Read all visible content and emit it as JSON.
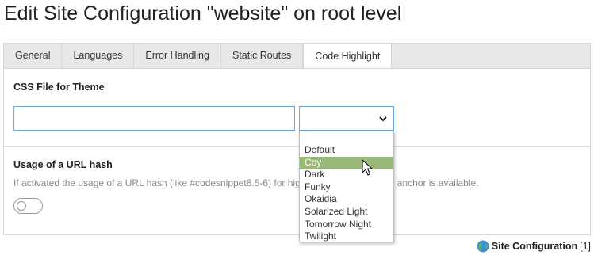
{
  "page": {
    "title": "Edit Site Configuration \"website\" on root level"
  },
  "tabs": [
    {
      "label": "General",
      "active": false
    },
    {
      "label": "Languages",
      "active": false
    },
    {
      "label": "Error Handling",
      "active": false
    },
    {
      "label": "Static Routes",
      "active": false
    },
    {
      "label": "Code Highlight",
      "active": true
    }
  ],
  "css_theme": {
    "label": "CSS File for Theme",
    "input_value": "",
    "select_value": "",
    "options": [
      "Default",
      "Coy",
      "Dark",
      "Funky",
      "Okaidia",
      "Solarized Light",
      "Tomorrow Night",
      "Twilight"
    ],
    "hovered_option": "Coy"
  },
  "url_hash": {
    "label": "Usage of a URL hash",
    "help_visible_left": "If activated the usage of a URL hash (like #codesnippet8.5-6) for hig",
    "help_visible_right": "anchor is available.",
    "enabled": false
  },
  "footer": {
    "record_name": "Site Configuration",
    "record_count": "[1]",
    "icon": "globe-icon"
  },
  "colors": {
    "accent_border": "#6aa8d8",
    "hover_option": "#99b87a"
  }
}
